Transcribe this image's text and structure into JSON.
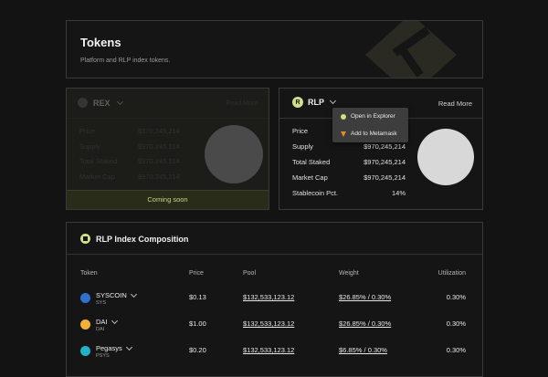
{
  "header": {
    "title": "Tokens",
    "subtitle": "Platform and RLP index tokens."
  },
  "rex": {
    "name": "REX",
    "read_more": "Read More",
    "rows": [
      {
        "label": "Price",
        "value": "$970,245,214"
      },
      {
        "label": "Supply",
        "value": "$970,245,214"
      },
      {
        "label": "Total Staked",
        "value": "$970,245,214"
      },
      {
        "label": "Market Cap",
        "value": "$970,245,214"
      }
    ],
    "status": "Coming soon"
  },
  "rlp": {
    "name": "RLP",
    "read_more": "Read More",
    "rows": [
      {
        "label": "Price",
        "value": ""
      },
      {
        "label": "Supply",
        "value": "$970,245,214"
      },
      {
        "label": "Total Staked",
        "value": "$970,245,214"
      },
      {
        "label": "Market Cap",
        "value": "$970,245,214"
      },
      {
        "label": "Stablecoin Pct.",
        "value": "14%"
      }
    ],
    "dropdown": {
      "explorer": "Open in Explorer",
      "metamask": "Add to Metamask"
    }
  },
  "composition": {
    "title": "RLP Index Composition",
    "columns": {
      "token": "Token",
      "price": "Price",
      "pool": "Pool",
      "weight": "Weight",
      "utilization": "Utilization"
    },
    "rows": [
      {
        "name": "SYSCOIN",
        "symbol": "SYS",
        "price": "$0.13",
        "pool": "$132,533,123.12",
        "weight": "$26.85% / 0.30%",
        "utilization": "0.30%",
        "color": "#2f6fd0"
      },
      {
        "name": "DAI",
        "symbol": "DAI",
        "price": "$1.00",
        "pool": "$132,533,123.12",
        "weight": "$26.85% / 0.30%",
        "utilization": "0.30%",
        "color": "#f2b134"
      },
      {
        "name": "Pegasys",
        "symbol": "PSYS",
        "price": "$0.20",
        "pool": "$132,533,123.12",
        "weight": "$6.85% / 0.30%",
        "utilization": "0.30%",
        "color": "#21b1c9"
      }
    ]
  }
}
